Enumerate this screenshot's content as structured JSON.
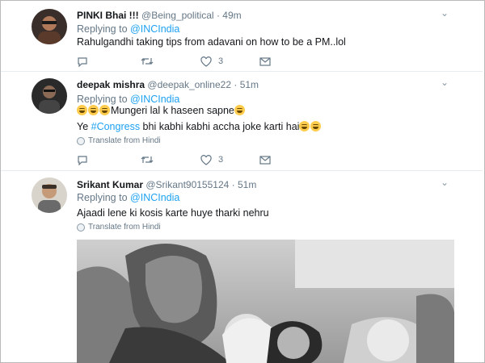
{
  "tweets": [
    {
      "name": "PINKI Bhai !!!",
      "handle": "@Being_political",
      "time": "49m",
      "replying_label": "Replying to",
      "replying_mention": "@INCIndia",
      "text_lines": [
        "Rahulgandhi taking tips from adavani on how to be a PM..lol"
      ],
      "likes": "3"
    },
    {
      "name": "deepak mishra",
      "handle": "@deepak_online22",
      "time": "51m",
      "replying_label": "Replying to",
      "replying_mention": "@INCIndia",
      "line1": "Mungeri lal k haseen sapne",
      "line2_pre": "Ye ",
      "line2_hashtag": "#Congress",
      "line2_post": " bhi kabhi kabhi accha joke karti hai",
      "translate": "Translate from Hindi",
      "likes": "3"
    },
    {
      "name": "Srikant Kumar",
      "handle": "@Srikant90155124",
      "time": "51m",
      "replying_label": "Replying to",
      "replying_mention": "@INCIndia",
      "text_lines": [
        "Ajaadi lene ki kosis karte huye tharki nehru"
      ],
      "translate": "Translate from Hindi"
    }
  ],
  "separator": "·",
  "icons": {
    "reply": "reply-icon",
    "retweet": "retweet-icon",
    "like": "heart-icon",
    "dm": "envelope-icon",
    "more": "chevron-down-icon",
    "emoji": "joy-emoji-icon",
    "globe": "globe-icon"
  },
  "colors": {
    "link": "#1da1f2",
    "muted": "#657786",
    "text": "#14171a"
  }
}
